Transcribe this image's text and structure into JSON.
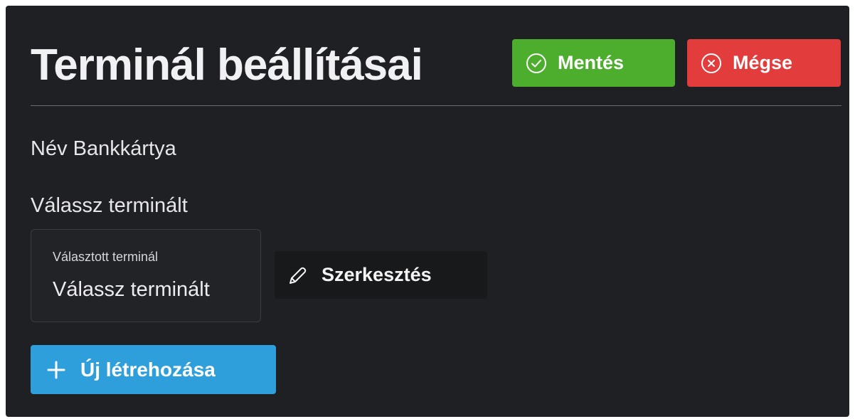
{
  "dialog": {
    "title": "Terminál beállításai",
    "save_label": "Mentés",
    "cancel_label": "Mégse",
    "name_label": "Név",
    "name_value": "Bankkártya",
    "choose_label": "Válassz terminált",
    "select": {
      "caption": "Választott terminál",
      "value": "Válassz terminált"
    },
    "edit_label": "Szerkesztés",
    "create_label": "Új létrehozása"
  },
  "icons": {
    "save": "check-circle-icon",
    "cancel": "x-circle-icon",
    "edit": "pencil-icon",
    "create": "plus-icon"
  },
  "colors": {
    "background": "#1f2023",
    "save": "#4cae2c",
    "cancel": "#e23c3c",
    "create": "#2f9fdc",
    "edit": "#18191b"
  }
}
